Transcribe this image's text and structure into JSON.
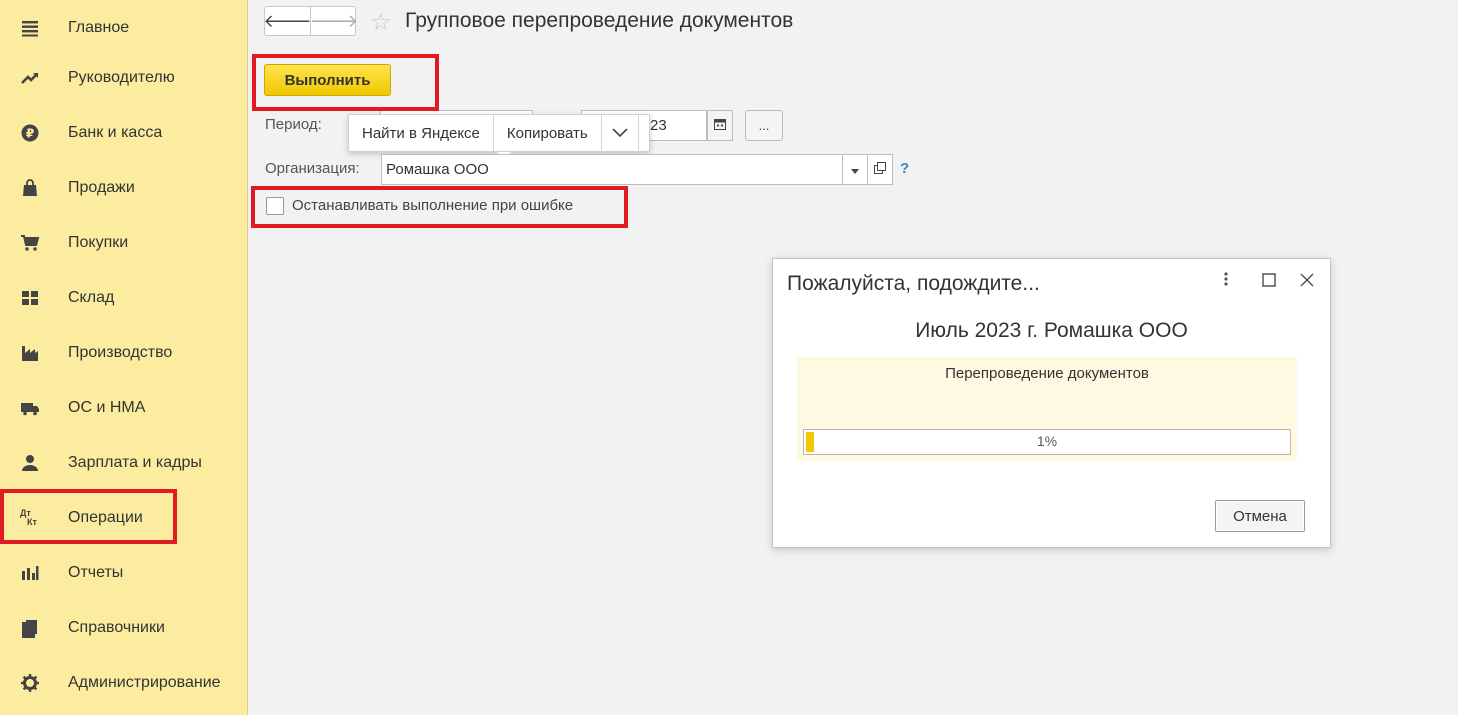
{
  "sidebar": {
    "items": [
      {
        "label": "Главное",
        "icon": "menu-icon"
      },
      {
        "label": "Руководителю",
        "icon": "trend-icon"
      },
      {
        "label": "Банк и касса",
        "icon": "ruble-icon"
      },
      {
        "label": "Продажи",
        "icon": "bag-icon"
      },
      {
        "label": "Покупки",
        "icon": "cart-icon"
      },
      {
        "label": "Склад",
        "icon": "warehouse-icon"
      },
      {
        "label": "Производство",
        "icon": "factory-icon"
      },
      {
        "label": "ОС и НМА",
        "icon": "truck-icon"
      },
      {
        "label": "Зарплата и кадры",
        "icon": "person-icon"
      },
      {
        "label": "Операции",
        "icon": "dt-kt-icon"
      },
      {
        "label": "Отчеты",
        "icon": "bar-chart-icon"
      },
      {
        "label": "Справочники",
        "icon": "books-icon"
      },
      {
        "label": "Администрирование",
        "icon": "gear-icon"
      }
    ],
    "dtkt_top": "Дт",
    "dtkt_bottom": "Кт"
  },
  "header": {
    "back_arrow": "🡐",
    "forward_arrow": "🡒",
    "star": "☆",
    "title": "Групповое перепроведение документов"
  },
  "toolbar": {
    "run_label": "Выполнить"
  },
  "form": {
    "period_label": "Период:",
    "period_end_value": "23",
    "period_select_label": "...",
    "org_label": "Организация:",
    "org_value": "Ромашка ООО",
    "help": "?",
    "checkbox_label": "Останавливать выполнение при ошибке"
  },
  "context_menu": {
    "items": [
      "Найти в Яндексе",
      "Копировать"
    ]
  },
  "dialog": {
    "title": "Пожалуйста, подождите...",
    "subtitle": "Июль 2023 г. Ромашка ООО",
    "operation": "Перепроведение документов",
    "progress_text": "1%",
    "progress_value": 1,
    "cancel_label": "Отмена"
  },
  "colors": {
    "sidebar_bg": "#fbeca0",
    "accent_yellow": "#f0c800",
    "highlight_red": "#e11b22",
    "help_blue": "#3a86c8"
  }
}
